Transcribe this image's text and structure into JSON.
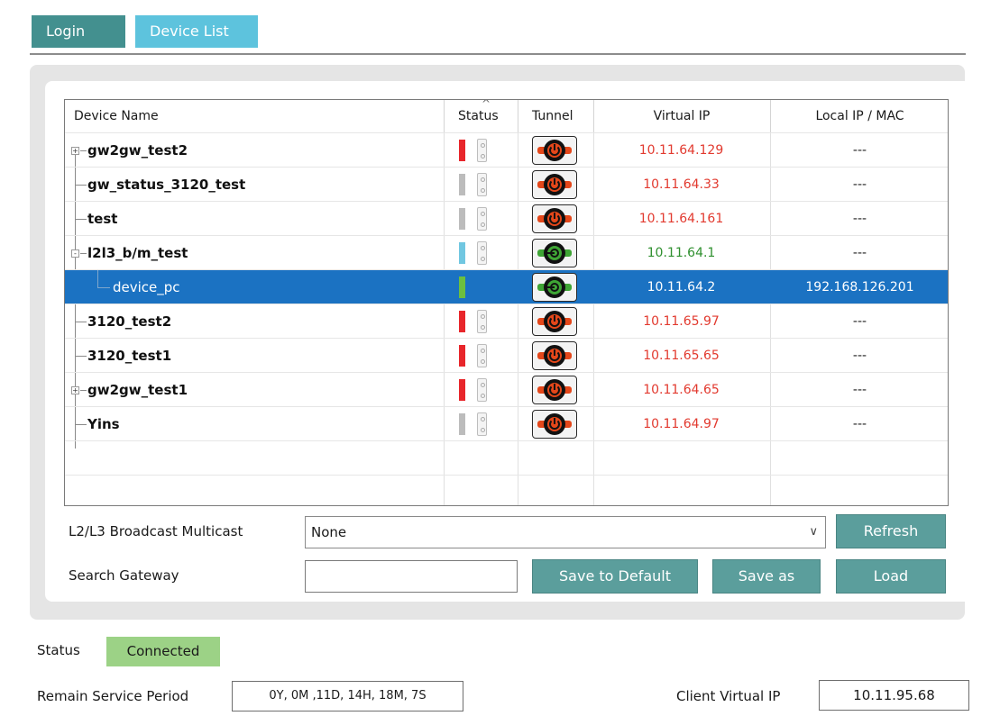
{
  "tabs": {
    "login": "Login",
    "device_list": "Device List"
  },
  "grid": {
    "headers": {
      "device_name": "Device Name",
      "status": "Status",
      "tunnel": "Tunnel",
      "virtual_ip": "Virtual IP",
      "local_ip": "Local IP / MAC"
    },
    "rows": [
      {
        "name": "gw2gw_test2",
        "status_color": "#e8262b",
        "tunnel": "off",
        "virtual_ip": "10.11.64.129",
        "local_ip": "---"
      },
      {
        "name": "gw_status_3120_test",
        "status_color": "#bcbcbc",
        "tunnel": "off",
        "virtual_ip": "10.11.64.33",
        "local_ip": "---"
      },
      {
        "name": "test",
        "status_color": "#bcbcbc",
        "tunnel": "off",
        "virtual_ip": "10.11.64.161",
        "local_ip": "---"
      },
      {
        "name": "l2l3_b/m_test",
        "status_color": "#71c7e1",
        "tunnel": "on",
        "virtual_ip": "10.11.64.1",
        "local_ip": "---"
      },
      {
        "name": "device_pc",
        "status_color": "#6cbf3f",
        "tunnel": "on",
        "virtual_ip": "10.11.64.2",
        "local_ip": "192.168.126.201"
      },
      {
        "name": "3120_test2",
        "status_color": "#e8262b",
        "tunnel": "off",
        "virtual_ip": "10.11.65.97",
        "local_ip": "---"
      },
      {
        "name": "3120_test1",
        "status_color": "#e8262b",
        "tunnel": "off",
        "virtual_ip": "10.11.65.65",
        "local_ip": "---"
      },
      {
        "name": "gw2gw_test1",
        "status_color": "#e8262b",
        "tunnel": "off",
        "virtual_ip": "10.11.64.65",
        "local_ip": "---"
      },
      {
        "name": "Yins",
        "status_color": "#bcbcbc",
        "tunnel": "off",
        "virtual_ip": "10.11.64.97",
        "local_ip": "---"
      }
    ]
  },
  "colors": {
    "ip_offline": "#e23a2f",
    "ip_online": "#2e8f2e",
    "selected_row": "#1b72c2",
    "tunnel_off": "#e4471a",
    "tunnel_on": "#3fa535"
  },
  "controls": {
    "broadcast_label": "L2/L3 Broadcast Multicast",
    "broadcast_value": "None",
    "search_label": "Search Gateway",
    "search_value": "",
    "refresh": "Refresh",
    "save_default": "Save to Default",
    "save_as": "Save as",
    "load": "Load"
  },
  "footer": {
    "status_label": "Status",
    "status_value": "Connected",
    "remain_label": "Remain Service Period",
    "remain_value": "0Y, 0M ,11D, 14H, 18M, 7S",
    "client_ip_label": "Client Virtual IP",
    "client_ip_value": "10.11.95.68"
  }
}
